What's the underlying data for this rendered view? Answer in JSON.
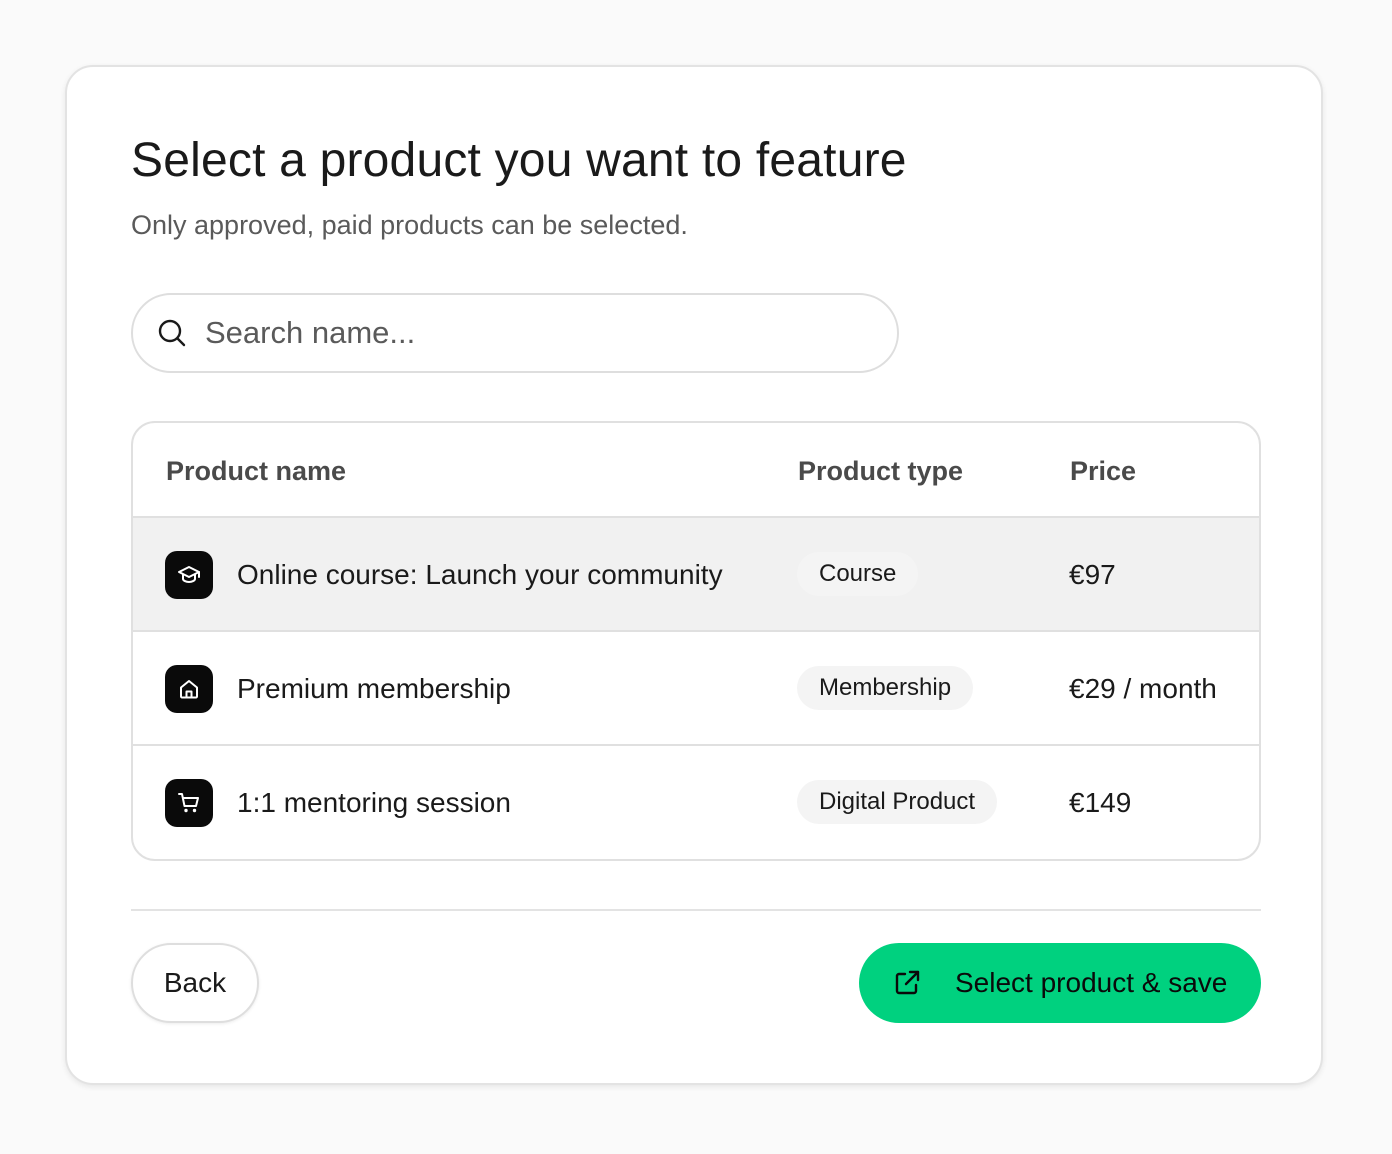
{
  "dialog": {
    "title": "Select a product you want to feature",
    "subtitle": "Only approved, paid products can be selected."
  },
  "search": {
    "placeholder": "Search name...",
    "value": "",
    "icon": "search-icon"
  },
  "table": {
    "headers": {
      "name": "Product name",
      "type": "Product type",
      "price": "Price"
    },
    "rows": [
      {
        "icon": "graduation-cap-icon",
        "name": "Online course: Launch your community",
        "type": "Course",
        "price": "€97",
        "selected": true
      },
      {
        "icon": "home-icon",
        "name": "Premium membership",
        "type": "Membership",
        "price": "€29 / month",
        "selected": false
      },
      {
        "icon": "shopping-cart-icon",
        "name": "1:1 mentoring session",
        "type": "Digital Product",
        "price": "€149",
        "selected": false
      }
    ]
  },
  "footer": {
    "back_label": "Back",
    "primary_label": "Select product & save",
    "primary_icon": "external-link-icon"
  },
  "colors": {
    "accent": "#00d17f",
    "icon_background": "#0a0a0a",
    "selected_row": "#f1f1f1"
  }
}
